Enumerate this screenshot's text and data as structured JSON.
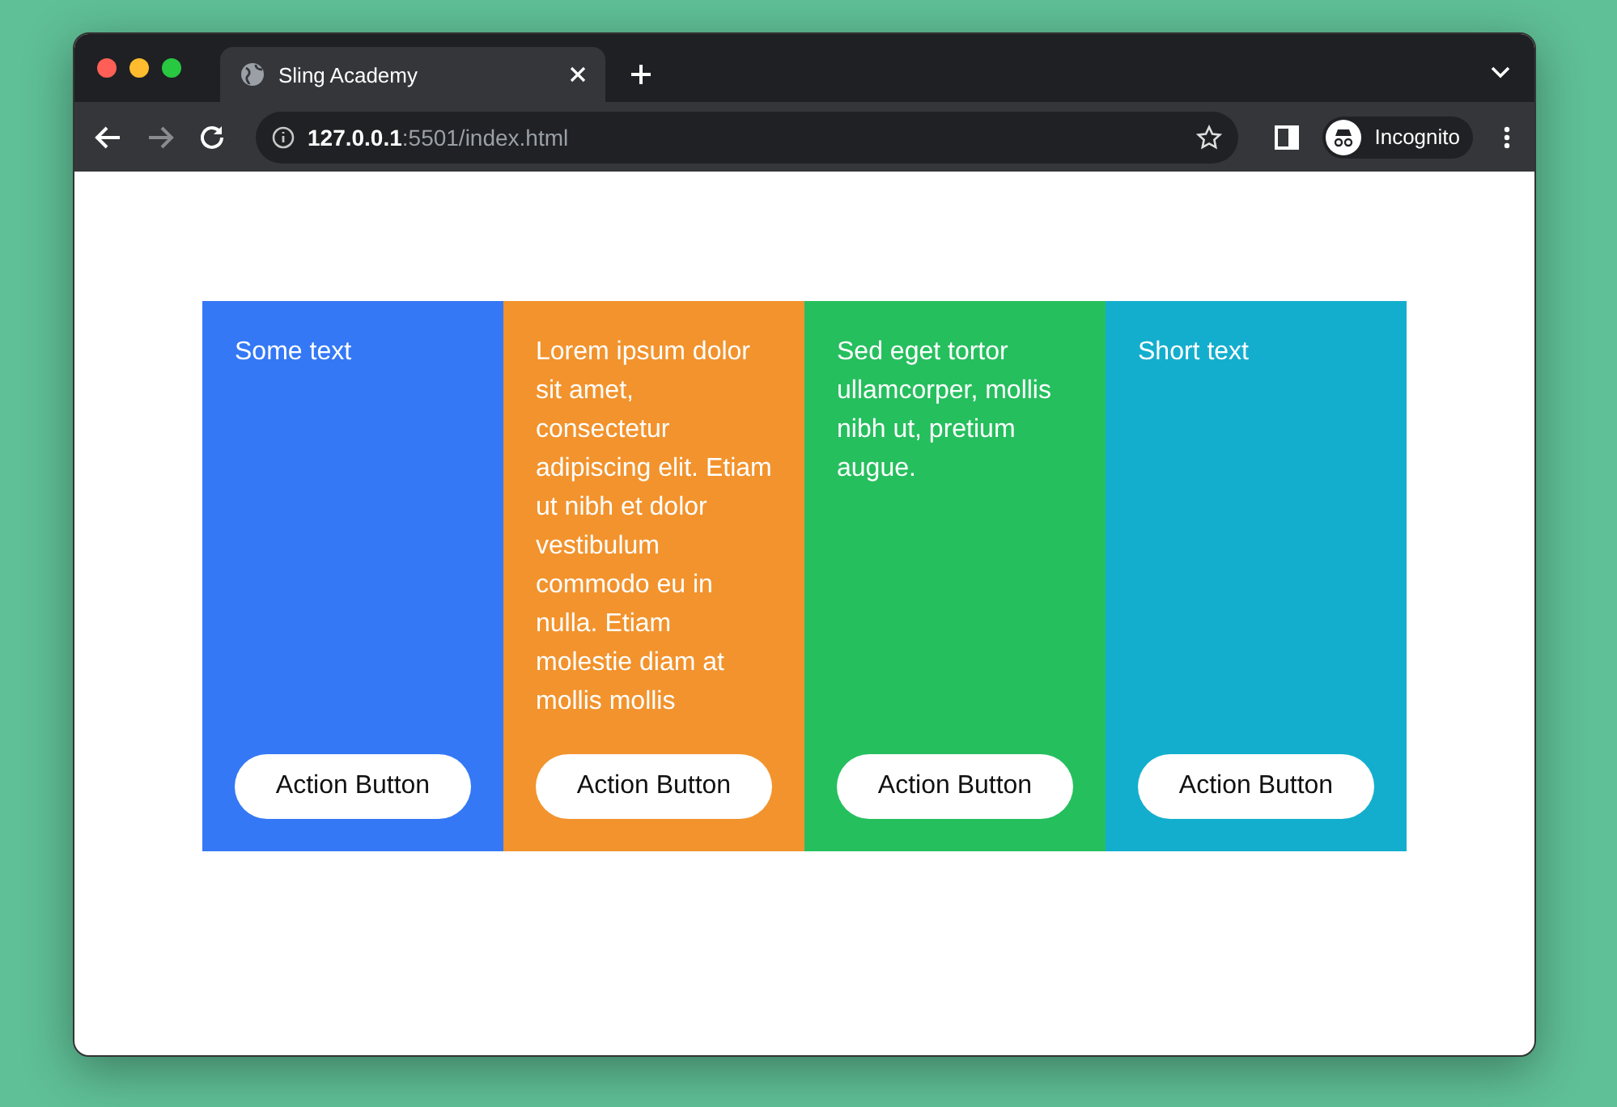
{
  "browser": {
    "tab": {
      "title": "Sling Academy",
      "selected": true
    },
    "address": {
      "host": "127.0.0.1",
      "rest": ":5501/index.html"
    },
    "profile": "Incognito"
  },
  "cards": [
    {
      "text": "Some text",
      "color": "#3478f6",
      "button": "Action Button"
    },
    {
      "text": "Lorem ipsum dolor sit amet, consectetur adipiscing elit. Etiam ut nibh et dolor vestibulum commodo eu in nulla. Etiam molestie diam at mollis mollis",
      "color": "#f2932d",
      "button": "Action Button"
    },
    {
      "text": "Sed eget tortor ullamcorper, mollis nibh ut, pretium augue.",
      "color": "#26bf5e",
      "button": "Action Button"
    },
    {
      "text": "Short text",
      "color": "#13aece",
      "button": "Action Button"
    }
  ]
}
